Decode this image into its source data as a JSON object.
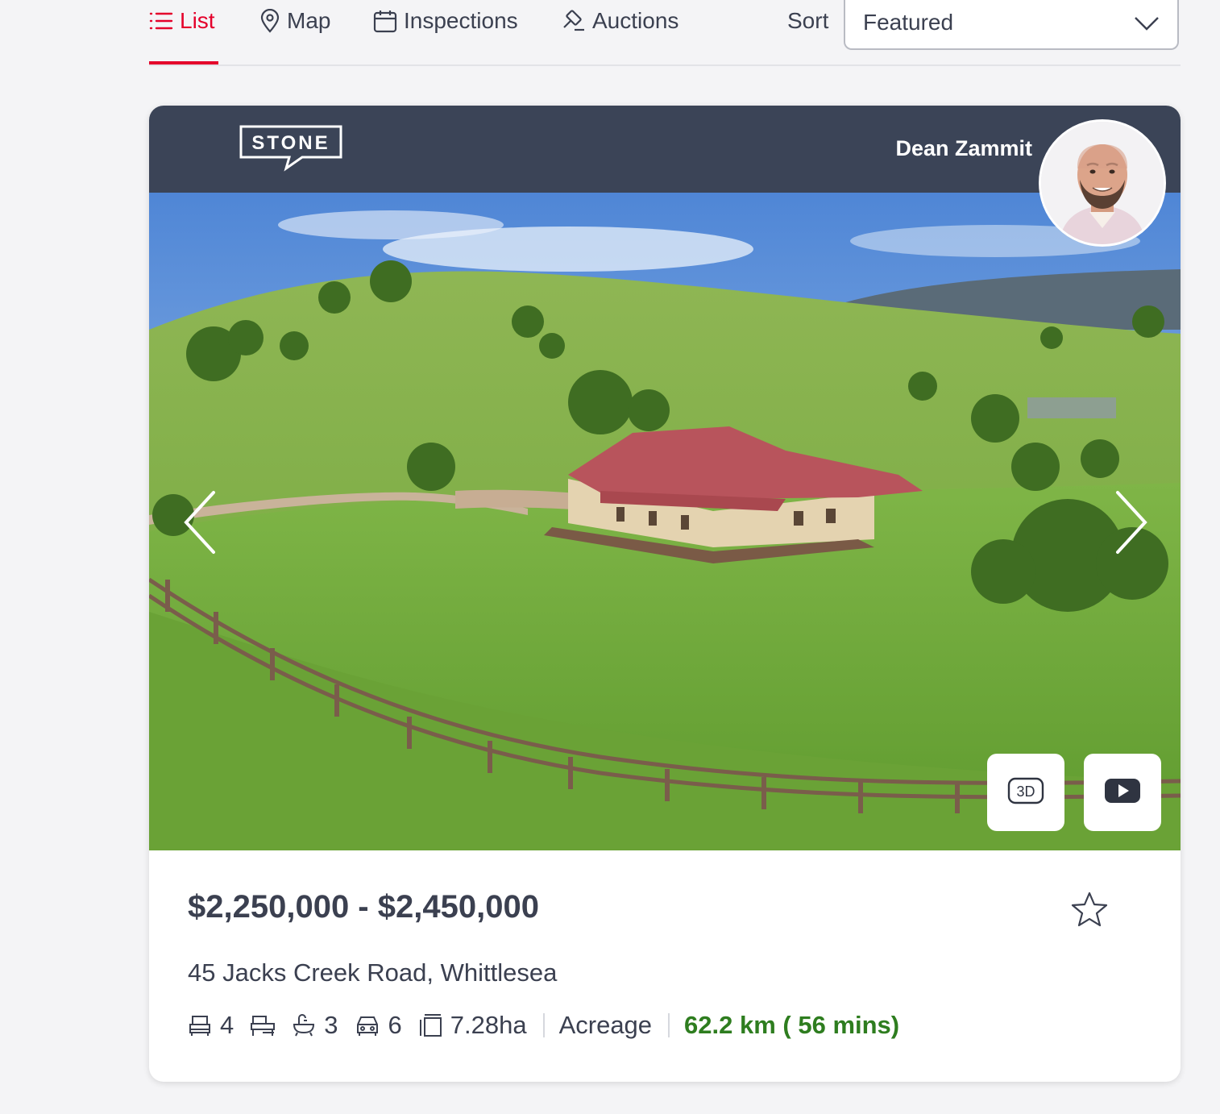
{
  "nav": {
    "tabs": [
      {
        "label": "List",
        "icon": "list-icon",
        "active": true
      },
      {
        "label": "Map",
        "icon": "map-pin-icon",
        "active": false
      },
      {
        "label": "Inspections",
        "icon": "calendar-icon",
        "active": false
      },
      {
        "label": "Auctions",
        "icon": "gavel-icon",
        "active": false
      }
    ],
    "sort_label": "Sort",
    "sort_value": "Featured"
  },
  "listing": {
    "agency_logo_text": "STONE",
    "agent_name": "Dean Zammit",
    "price": "$2,250,000 - $2,450,000",
    "address": "45 Jacks Creek Road, Whittlesea",
    "bedrooms": "4",
    "bathrooms": "3",
    "parking": "6",
    "land_size": "7.28ha",
    "property_type": "Acreage",
    "distance": "62.2 km ( 56 mins)",
    "media_3d_label": "3D"
  },
  "colors": {
    "accent": "#e4002b",
    "agency_bar": "#3b4457",
    "distance_green": "#2e7d1f",
    "text": "#3b4050"
  }
}
